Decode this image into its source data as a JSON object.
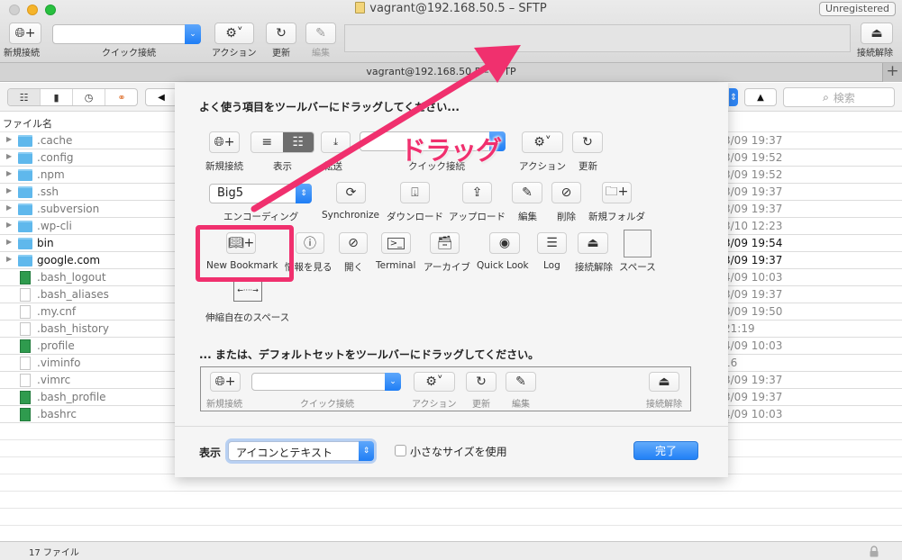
{
  "window": {
    "title": "vagrant@192.168.50.5 – SFTP",
    "unregistered_badge": "Unregistered"
  },
  "toolbar": {
    "new_connection": "新規接続",
    "quick_connect": "クイック接続",
    "quick_connect_value": "",
    "action": "アクション",
    "refresh": "更新",
    "edit": "編集",
    "disconnect": "接続解除"
  },
  "tab": {
    "title": "vagrant@192.168.50.5 – SFTP",
    "add_label": "+"
  },
  "browser": {
    "back_label": "◀",
    "up_label": "▲",
    "search_placeholder": "検索",
    "column_header": "ファイル名"
  },
  "files": [
    {
      "name": ".cache",
      "type": "folder",
      "date": "3/09 19:37",
      "dark": false
    },
    {
      "name": ".config",
      "type": "folder",
      "date": "3/09 19:52",
      "dark": false
    },
    {
      "name": ".npm",
      "type": "folder",
      "date": "3/09 19:52",
      "dark": false
    },
    {
      "name": ".ssh",
      "type": "folder",
      "date": "3/09 19:37",
      "dark": false
    },
    {
      "name": ".subversion",
      "type": "folder",
      "date": "3/09 19:37",
      "dark": false
    },
    {
      "name": ".wp-cli",
      "type": "folder",
      "date": "3/10 12:23",
      "dark": false
    },
    {
      "name": "bin",
      "type": "folder",
      "date": "3/09 19:54",
      "dark": true
    },
    {
      "name": "google.com",
      "type": "folder",
      "date": "3/09 19:37",
      "dark": true
    },
    {
      "name": ".bash_logout",
      "type": "script",
      "date": "4/09 10:03",
      "dark": false
    },
    {
      "name": ".bash_aliases",
      "type": "doc",
      "date": "3/09 19:37",
      "dark": false
    },
    {
      "name": ".my.cnf",
      "type": "doc",
      "date": "3/09 19:50",
      "dark": false
    },
    {
      "name": ".bash_history",
      "type": "doc",
      "date": "21:19",
      "dark": false
    },
    {
      "name": ".profile",
      "type": "script",
      "date": "4/09 10:03",
      "dark": false
    },
    {
      "name": ".viminfo",
      "type": "doc",
      "date": "16",
      "dark": false
    },
    {
      "name": ".vimrc",
      "type": "doc",
      "date": "3/09 19:37",
      "dark": false
    },
    {
      "name": ".bash_profile",
      "type": "script",
      "date": "3/09 19:37",
      "dark": false
    },
    {
      "name": ".bashrc",
      "type": "script",
      "date": "4/09 10:03",
      "dark": false
    }
  ],
  "status": {
    "file_count": "17 ファイル"
  },
  "sheet": {
    "heading_drag": "よく使う項目をツールバーにドラッグしてください...",
    "heading_default": "... または、デフォルトセットをツールバーにドラッグしてください。",
    "items": {
      "new_connection": "新規接続",
      "view": "表示",
      "transfer": "転送",
      "quick_connect": "クイック接続",
      "action": "アクション",
      "refresh": "更新",
      "encoding": "エンコーディング",
      "encoding_value": "Big5",
      "synchronize": "Synchronize",
      "download": "ダウンロード",
      "upload": "アップロード",
      "edit": "編集",
      "delete": "削除",
      "new_folder": "新規フォルダ",
      "new_bookmark": "New Bookmark",
      "info": "情報を見る",
      "open": "開く",
      "terminal": "Terminal",
      "archive": "アーカイブ",
      "quick_look": "Quick Look",
      "log": "Log",
      "disconnect": "接続解除",
      "space": "スペース",
      "flexible_space": "伸縮自在のスペース"
    },
    "default_set": {
      "new_connection": "新規接続",
      "quick_connect": "クイック接続",
      "action": "アクション",
      "refresh": "更新",
      "edit": "編集",
      "disconnect": "接続解除"
    },
    "footer": {
      "show_label": "表示",
      "show_value": "アイコンとテキスト",
      "small_size_label": "小さなサイズを使用",
      "small_size_checked": false,
      "done_label": "完了"
    }
  },
  "annotation": {
    "drag_text": "ドラッグ",
    "color": "#f0306e"
  }
}
